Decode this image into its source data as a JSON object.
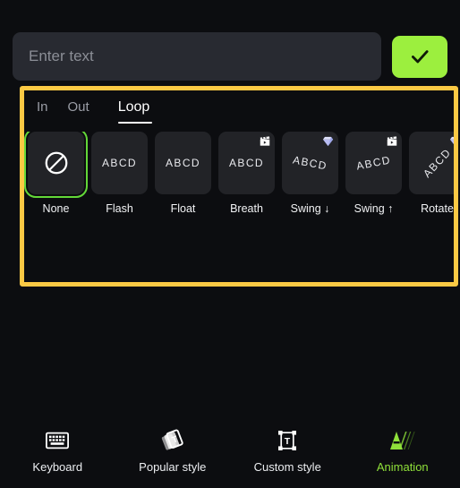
{
  "colors": {
    "background": "#0c0d10",
    "accent_green": "#9cef3e",
    "highlight_yellow": "#fbc944",
    "selection_green": "#63d838",
    "card": "#222327",
    "input_bg": "#282a31"
  },
  "input": {
    "placeholder": "Enter text",
    "value": "",
    "confirm_icon": "check-icon"
  },
  "panel": {
    "tabs": [
      {
        "label": "In",
        "active": false
      },
      {
        "label": "Out",
        "active": false
      },
      {
        "label": "Loop",
        "active": true
      }
    ],
    "items": [
      {
        "label": "None",
        "preview": "",
        "style": "none",
        "badge": "none",
        "selected": true
      },
      {
        "label": "Flash",
        "preview": "ABCD",
        "style": "flat",
        "badge": "none",
        "selected": false
      },
      {
        "label": "Float",
        "preview": "ABCD",
        "style": "flat",
        "badge": "none",
        "selected": false
      },
      {
        "label": "Breath",
        "preview": "ABCD",
        "style": "flat",
        "badge": "video-badge",
        "selected": false
      },
      {
        "label": "Swing ↓",
        "preview": "ABCD",
        "style": "tilt-down",
        "badge": "gem-badge",
        "selected": false
      },
      {
        "label": "Swing ↑",
        "preview": "ABCD",
        "style": "tilt-up",
        "badge": "video-badge",
        "selected": false
      },
      {
        "label": "Rotate",
        "preview": "ABCD",
        "style": "rotate",
        "badge": "gem-badge",
        "selected": false
      }
    ]
  },
  "bottom_nav": [
    {
      "label": "Keyboard",
      "icon": "keyboard-icon",
      "active": false
    },
    {
      "label": "Popular style",
      "icon": "cards-text-icon",
      "active": false
    },
    {
      "label": "Custom style",
      "icon": "text-box-icon",
      "active": false
    },
    {
      "label": "Animation",
      "icon": "animation-a-icon",
      "active": true
    }
  ]
}
